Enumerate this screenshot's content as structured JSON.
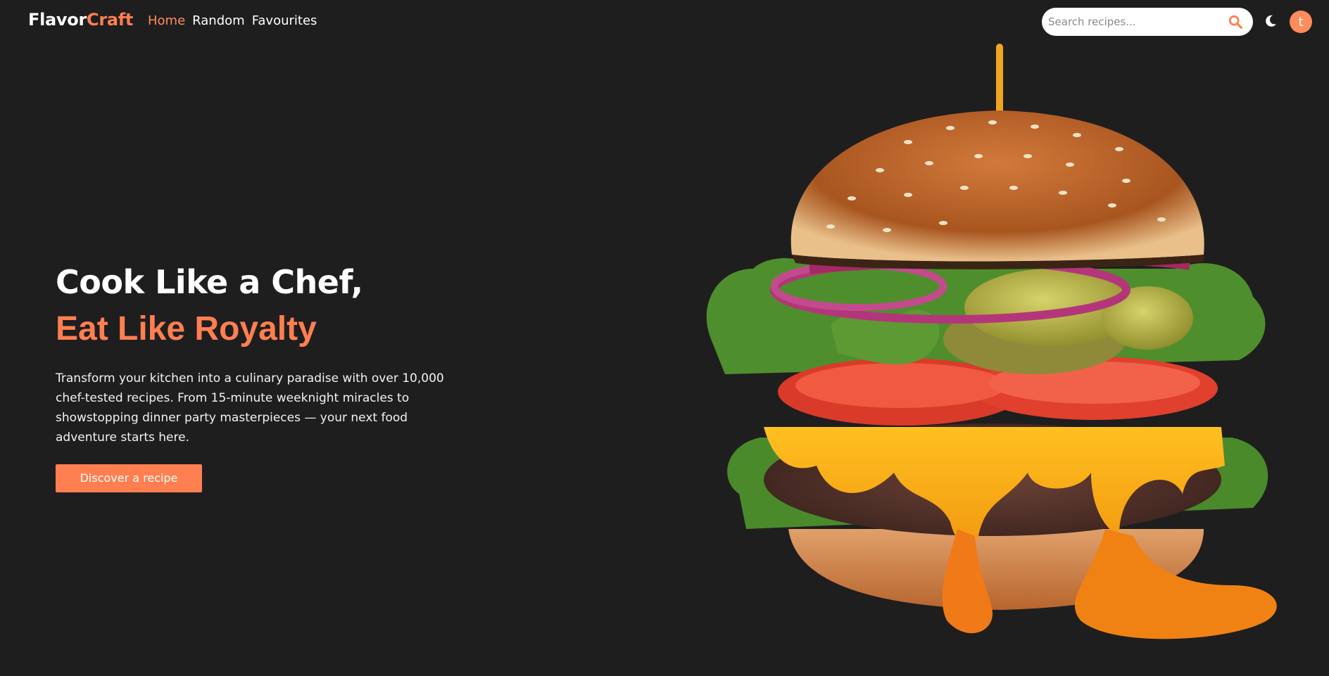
{
  "brand": {
    "part1": "Flavor",
    "part2": "Craft"
  },
  "nav": {
    "links": [
      {
        "label": "Home",
        "active": true
      },
      {
        "label": "Random",
        "active": false
      },
      {
        "label": "Favourites",
        "active": false
      }
    ]
  },
  "search": {
    "placeholder": "Search recipes...",
    "icon": "search-icon"
  },
  "theme_toggle": {
    "icon": "moon-icon"
  },
  "user": {
    "avatar_letter": "t"
  },
  "hero": {
    "title_line1": "Cook Like a Chef,",
    "title_line2": "Eat Like Royalty",
    "description": "Transform your kitchen into a culinary paradise with over 10,000 chef-tested recipes. From 15-minute weeknight miracles to showstopping dinner party masterpieces — your next food adventure starts here.",
    "cta_label": "Discover a recipe"
  },
  "colors": {
    "accent": "#ff7f50",
    "background": "#1e1e1f",
    "text": "#ffffff"
  }
}
